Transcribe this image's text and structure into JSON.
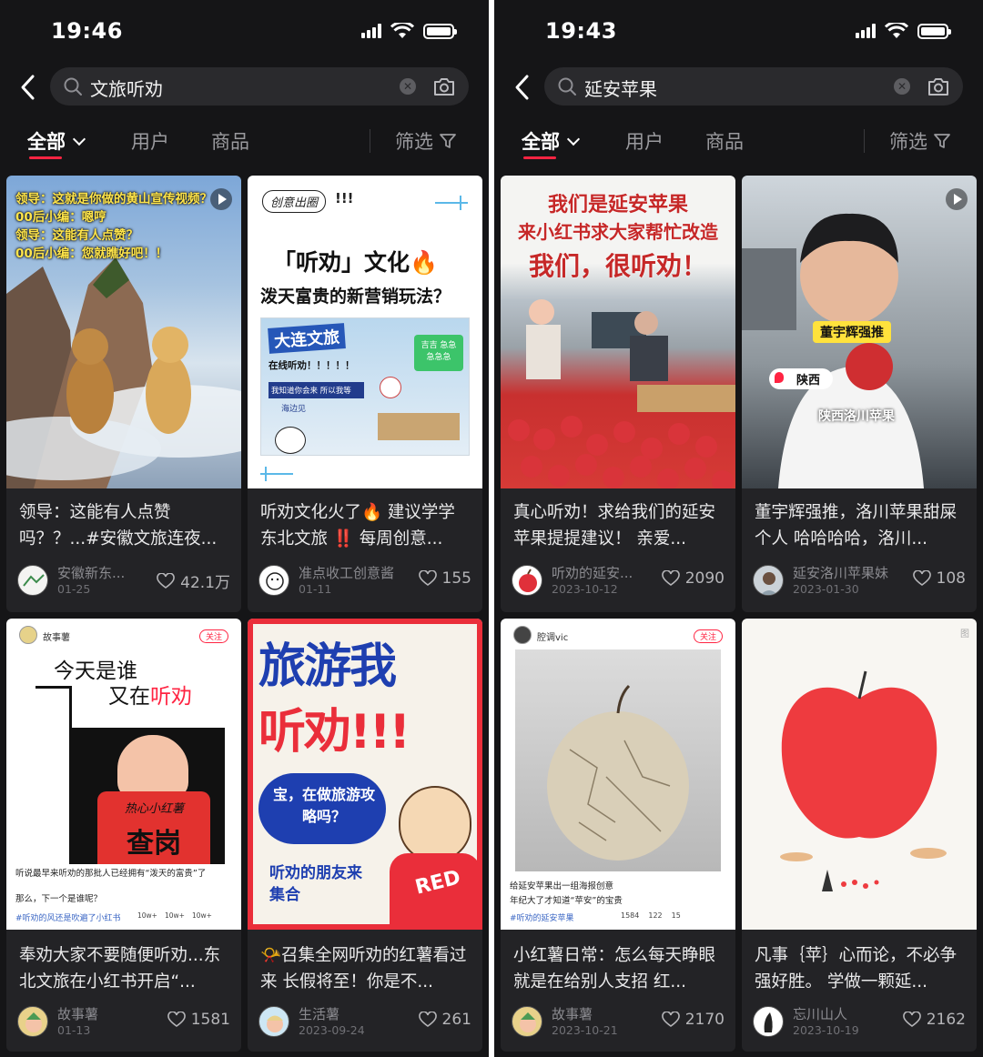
{
  "left": {
    "status": {
      "time": "19:46"
    },
    "search": {
      "query": "文旅听劝"
    },
    "tabs": {
      "all": "全部",
      "users": "用户",
      "goods": "商品",
      "filter": "筛选"
    },
    "cards": [
      {
        "overlay": [
          "领导：这就是你做的黄山宣传视频？",
          "00后小编：嗯哼",
          "领导：这能有人点赞？",
          "00后小编：您就瞧好吧！！"
        ],
        "title": "领导：这能有人点赞吗？？...#安徽文旅连夜...",
        "author": "安徽新东...",
        "date": "01-25",
        "likes": "42.1万"
      },
      {
        "overlay": {
          "badge": "创意出圈",
          "excl": "!!!",
          "line1": "「听劝」文化🔥",
          "line2": "泼天富贵的新营销玩法？",
          "brand": "大连文旅",
          "sub": "在线听劝！！！！！",
          "sign": "我知道你会来 所以我等",
          "place": "海边见",
          "sticker": "吉吉 急急急急急"
        },
        "title": "听劝文化火了🔥 建议学学东北文旅 ‼️ 每周创意...",
        "author": "准点收工创意酱",
        "date": "01-11",
        "likes": "155"
      },
      {
        "overlay": {
          "user": "故事薯",
          "follow": "关注",
          "line1": "今天是谁",
          "line2a": "又在",
          "line2b": "听劝",
          "shirt": "热心小红薯",
          "stamp": "查岗",
          "cap1": "听说最早来听劝的那批人已经拥有“泼天的富贵”了",
          "cap2": "那么，下一个是谁呢？",
          "tag": "#听劝的风还是吹遍了小红书",
          "s1": "10w+",
          "s2": "10w+",
          "s3": "10w+"
        },
        "title": "奉劝大家不要随便听劝...东北文旅在小红书开启“...",
        "author": "故事薯",
        "date": "01-13",
        "likes": "1581"
      },
      {
        "overlay": {
          "big1": "旅游我",
          "big2": "听劝!!!",
          "bubble": "宝，在做旅游攻略吗？",
          "friends": "听劝的朋友来集合",
          "shirt": "RED"
        },
        "title": "📯召集全网听劝的红薯看过来 长假将至！你是不...",
        "author": "生活薯",
        "date": "2023-09-24",
        "likes": "261"
      }
    ]
  },
  "right": {
    "status": {
      "time": "19:43"
    },
    "search": {
      "query": "延安苹果"
    },
    "tabs": {
      "all": "全部",
      "users": "用户",
      "goods": "商品",
      "filter": "筛选"
    },
    "cards": [
      {
        "overlay": [
          "我们是延安苹果",
          "来小红书求大家帮忙改造",
          "我们，很听劝！"
        ],
        "title": "真心听劝！求给我们的延安苹果提提建议！ 亲爱...",
        "author": "听劝的延安...",
        "date": "2023-10-12",
        "likes": "2090"
      },
      {
        "overlay": {
          "name": "董宇辉强推",
          "loc": "陕西",
          "caption": "陕西洛川苹果"
        },
        "title": "董宇辉强推，洛川苹果甜屎个人 哈哈哈哈，洛川...",
        "author": "延安洛川苹果妹",
        "date": "2023-01-30",
        "likes": "108"
      },
      {
        "overlay": {
          "user": "腔调vic",
          "follow": "关注",
          "cap1": "给延安苹果出一组海报创意",
          "cap2": "年纪大了才知道“苹安”的宝贵",
          "tag": "#听劝的延安苹果",
          "s1": "1584",
          "s2": "122",
          "s3": "15"
        },
        "title": "小红薯日常：怎么每天睁眼就是在给别人支招 红...",
        "author": "故事薯",
        "date": "2023-10-21",
        "likes": "2170"
      },
      {
        "overlay": {
          "mark": "图"
        },
        "title": "凡事｛苹｝心而论，不必争强好胜。 学做一颗延...",
        "author": "忘川山人",
        "date": "2023-10-19",
        "likes": "2162"
      }
    ]
  },
  "colors": {
    "accent": "#ff2442",
    "bg": "#151517",
    "card": "#232326"
  },
  "icons": [
    "back-chevron-icon",
    "search-icon",
    "clear-icon",
    "camera-icon",
    "filter-funnel-icon",
    "heart-icon",
    "play-icon",
    "signal-icon",
    "wifi-icon",
    "battery-icon"
  ]
}
